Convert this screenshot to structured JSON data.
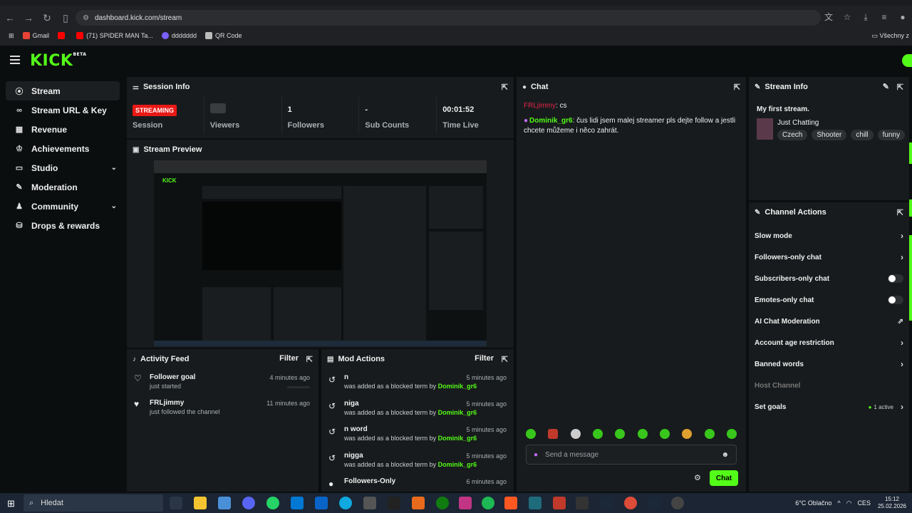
{
  "browser": {
    "url": "dashboard.kick.com/stream",
    "bookmarks": [
      {
        "label": "Gmail",
        "color": "#ea4335"
      },
      {
        "label": "",
        "color": "#ff0000"
      },
      {
        "label": "(71) SPIDER MAN Ta...",
        "color": "#ff0000"
      },
      {
        "label": "ddddddd",
        "color": "#7b61ff"
      },
      {
        "label": "QR Code",
        "color": "#bbbbbb"
      }
    ],
    "all_bookmarks": "Všechny z"
  },
  "header": {
    "logo": "KICK",
    "logo_sup": "BETA"
  },
  "sidebar": {
    "items": [
      {
        "label": "Stream",
        "icon": "signal-icon",
        "glyph": "((·))",
        "active": true
      },
      {
        "label": "Stream URL & Key",
        "icon": "link-icon",
        "glyph": "🔗"
      },
      {
        "label": "Revenue",
        "icon": "chart-icon",
        "glyph": "▦"
      },
      {
        "label": "Achievements",
        "icon": "trophy-icon",
        "glyph": "🏆"
      },
      {
        "label": "Studio",
        "icon": "studio-icon",
        "glyph": "▭",
        "chevron": true
      },
      {
        "label": "Moderation",
        "icon": "wrench-icon",
        "glyph": "🔧"
      },
      {
        "label": "Community",
        "icon": "community-icon",
        "glyph": "👥",
        "chevron": true
      },
      {
        "label": "Drops & rewards",
        "icon": "gift-icon",
        "glyph": "⛀"
      }
    ]
  },
  "session": {
    "title": "Session Info",
    "status_badge": "STREAMING",
    "session_label": "Session",
    "viewers_label": "Viewers",
    "followers_value": "1",
    "followers_label": "Followers",
    "subs_value": "-",
    "subs_label": "Sub Counts",
    "time_value": "00:01:52",
    "time_label": "Time Live"
  },
  "preview": {
    "title": "Stream Preview"
  },
  "activity": {
    "title": "Activity Feed",
    "filter": "Filter",
    "items": [
      {
        "title": "Follower goal",
        "sub": "just started",
        "time": "4 minutes ago",
        "progress": true
      },
      {
        "title": "FRLjimmy",
        "sub": "just followed the channel",
        "time": "11 minutes ago"
      }
    ]
  },
  "mod": {
    "title": "Mod Actions",
    "filter": "Filter",
    "by_text": "was added as a blocked term by",
    "items": [
      {
        "term": "n",
        "user": "Dominik_gr6",
        "time": "5 minutes ago"
      },
      {
        "term": "niga",
        "user": "Dominik_gr6",
        "time": "5 minutes ago"
      },
      {
        "term": "n word",
        "user": "Dominik_gr6",
        "time": "5 minutes ago"
      },
      {
        "term": "nigga",
        "user": "Dominik_gr6",
        "time": "5 minutes ago"
      }
    ],
    "last": {
      "term": "Followers-Only",
      "time": "6 minutes ago"
    }
  },
  "chat": {
    "title": "Chat",
    "messages": [
      {
        "user": "FRLjimmy",
        "text": ": cs",
        "style": "u1"
      },
      {
        "user": "Dominik_gr6",
        "text": ": čus lidi jsem malej streamer pls dejte follow a jestli chcete můžeme i něco zahrát.",
        "style": "u2",
        "mic": true
      }
    ],
    "placeholder": "Send a message",
    "send": "Chat"
  },
  "stream_info": {
    "title": "Stream Info",
    "stream_title": "My first stream.",
    "category": "Just Chatting",
    "tags": [
      "Czech",
      "Shooter",
      "chill",
      "funny"
    ]
  },
  "channel_actions": {
    "title": "Channel Actions",
    "items": [
      {
        "label": "Slow mode",
        "kind": "chevron"
      },
      {
        "label": "Followers-only chat",
        "kind": "chevron"
      },
      {
        "label": "Subscribers-only chat",
        "kind": "toggle"
      },
      {
        "label": "Emotes-only chat",
        "kind": "toggle"
      },
      {
        "label": "AI Chat Moderation",
        "kind": "external"
      },
      {
        "label": "Account age restriction",
        "kind": "chevron"
      },
      {
        "label": "Banned words",
        "kind": "chevron"
      },
      {
        "label": "Host Channel",
        "kind": "dim"
      },
      {
        "label": "Set goals",
        "kind": "chevron",
        "badge": "1 active"
      }
    ]
  },
  "taskbar": {
    "search": "Hledat",
    "weather": "6°C  Oblačno",
    "lang": "CES",
    "time": "15:12",
    "date": "25.02.2026"
  }
}
